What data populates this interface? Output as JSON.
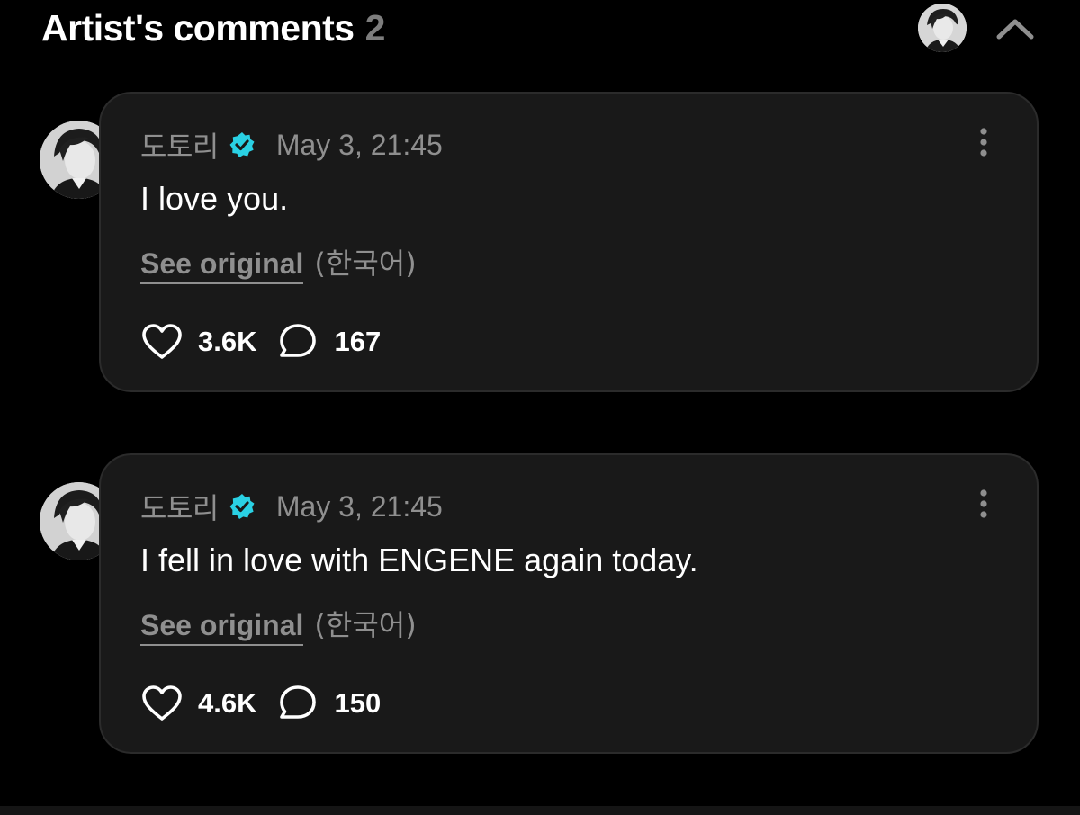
{
  "header": {
    "title": "Artist's comments",
    "count": "2",
    "avatar_icon": "artist-avatar",
    "collapse_icon": "chevron-up-icon"
  },
  "colors": {
    "background": "#000000",
    "bubble": "#191919",
    "muted_text": "#8f8f8f",
    "verified_badge": "#2ad1e4"
  },
  "comments": [
    {
      "author": "도토리",
      "verified": true,
      "timestamp": "May 3, 21:45",
      "text": "I love you.",
      "see_original_label": "See original",
      "language": "(한국어)",
      "likes": "3.6K",
      "replies": "167"
    },
    {
      "author": "도토리",
      "verified": true,
      "timestamp": "May 3, 21:45",
      "text": "I fell in love with ENGENE again today.",
      "see_original_label": "See original",
      "language": "(한국어)",
      "likes": "4.6K",
      "replies": "150"
    }
  ]
}
